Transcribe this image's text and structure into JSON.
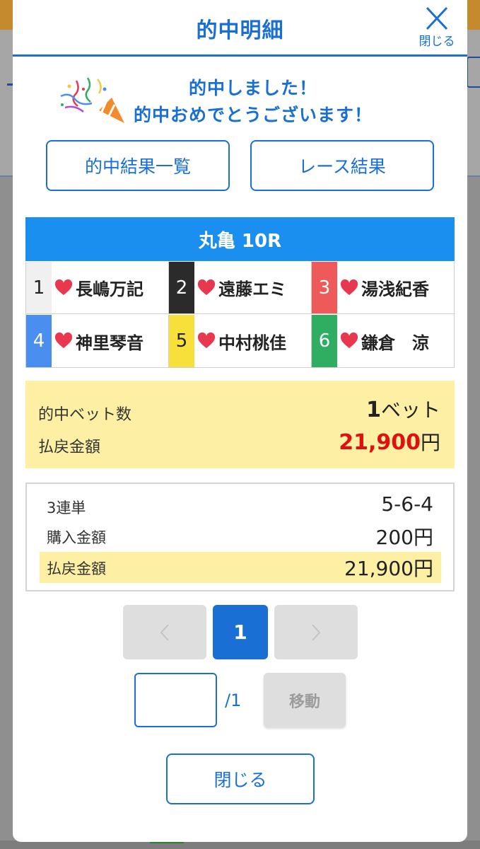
{
  "modal": {
    "title": "的中明細",
    "close_label": "閉じる"
  },
  "congrats": {
    "line1": "的中しました！",
    "line2": "的中おめでとうございます！"
  },
  "buttons": {
    "hit_list": "的中結果一覧",
    "race_result": "レース結果",
    "close": "閉じる",
    "move": "移動"
  },
  "race": {
    "title": "丸亀 10R",
    "racers": [
      {
        "num": "1",
        "name": "長嶋万記",
        "color": "#f0f0f0",
        "text_color": "#222222"
      },
      {
        "num": "2",
        "name": "遠藤エミ",
        "color": "#2b2b2b",
        "text_color": "#ffffff"
      },
      {
        "num": "3",
        "name": "湯浅紀香",
        "color": "#ee5a5a",
        "text_color": "#ffffff"
      },
      {
        "num": "4",
        "name": "神里琴音",
        "color": "#4a8ff0",
        "text_color": "#ffffff"
      },
      {
        "num": "5",
        "name": "中村桃佳",
        "color": "#f7e03a",
        "text_color": "#222222"
      },
      {
        "num": "6",
        "name": "鎌倉　涼",
        "color": "#2fae62",
        "text_color": "#ffffff"
      }
    ]
  },
  "summary": {
    "bet_count_label": "的中ベット数",
    "bet_count_value": "1",
    "bet_count_unit": "ベット",
    "payout_label": "払戻金額",
    "payout_value": "21,900",
    "payout_unit": "円"
  },
  "detail": {
    "bet_type": "3連単",
    "combination": "5-6-4",
    "purchase_label": "購入金額",
    "purchase_value": "200円",
    "payout_label": "払戻金額",
    "payout_value": "21,900円"
  },
  "pagination": {
    "prev": "‹",
    "current": "1",
    "next": "›",
    "total": "/1",
    "input_value": ""
  },
  "colors": {
    "accent": "#1a6fd4",
    "race_bar": "#1b8ff0",
    "highlight": "#fdf0a5",
    "payout_red": "#e01010",
    "heart": "#e8384f"
  }
}
